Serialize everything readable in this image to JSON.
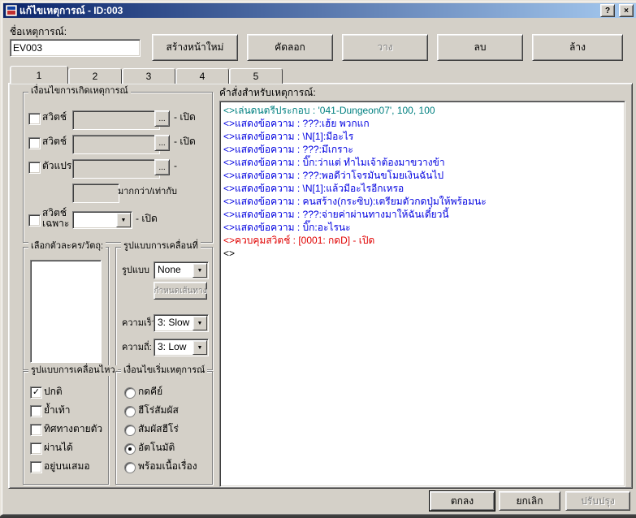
{
  "window": {
    "title": "แก้ไขเหตุการณ์ - ID:003"
  },
  "icons": {
    "help": "?",
    "close": "×",
    "dropdown_arrow": "▼",
    "spinner_up": "▲",
    "spinner_down": "▼",
    "ellipsis": "...",
    "check": "✓"
  },
  "header": {
    "name_label": "ชื่อเหตุการณ์:",
    "name_value": "EV003",
    "new_page_button": "สร้างหน้าใหม่",
    "copy_button": "คัดลอก",
    "paste_button": "วาง",
    "delete_button": "ลบ",
    "clear_button": "ล้าง"
  },
  "tabs": {
    "labels": [
      "1",
      "2",
      "3",
      "4",
      "5"
    ],
    "selected": "1"
  },
  "conditions": {
    "title": "เงื่อนไขการเกิดเหตุการณ์",
    "switch1": {
      "label": "สวิตช์",
      "value": "",
      "suffix": "- เปิด"
    },
    "switch2": {
      "label": "สวิตช์",
      "value": "",
      "suffix": "- เปิด"
    },
    "variable": {
      "label": "ตัวแปร",
      "value": "",
      "suffix": "-"
    },
    "compare": {
      "label": "มากกว่า/เท่ากับ",
      "value": ""
    },
    "self_switch": {
      "label_line1": "สวิตช์",
      "label_line2": "เฉพาะ",
      "value": "",
      "suffix": "- เปิด"
    }
  },
  "graphic": {
    "title": "เลือกตัวละคร/วัตถุ:"
  },
  "movement": {
    "title": "รูปแบบการเคลื่อนที่",
    "type_label": "รูปแบบ",
    "type_value": "None",
    "route_button": "กำหนดเส้นทาง",
    "speed_label": "ความเร็ว:",
    "speed_value": "3: Slow",
    "frequency_label": "ความถี่:",
    "frequency_value": "3: Low"
  },
  "options": {
    "title": "รูปแบบการเคลื่อนไหว",
    "items": [
      {
        "label": "ปกติ",
        "checked": true
      },
      {
        "label": "ย้ำเท้า",
        "checked": false
      },
      {
        "label": "ทิศทางตายตัว",
        "checked": false
      },
      {
        "label": "ผ่านได้",
        "checked": false
      },
      {
        "label": "อยู่บนเสมอ",
        "checked": false
      }
    ]
  },
  "trigger": {
    "title": "เงื่อนไขเริ่มเหตุการณ์",
    "items": [
      {
        "label": "กดคีย์",
        "selected": false
      },
      {
        "label": "ฮีโร่สัมผัส",
        "selected": false
      },
      {
        "label": "สัมผัสฮีโร่",
        "selected": false
      },
      {
        "label": "อัตโนมัติ",
        "selected": true
      },
      {
        "label": "พร้อมเนื้อเรื่อง",
        "selected": false
      }
    ]
  },
  "commands": {
    "title": "คำสั่งสำหรับเหตุการณ์:",
    "lines": [
      {
        "text": "<>เล่นดนตรีประกอบ : '041-Dungeon07', 100, 100",
        "color": "#008080"
      },
      {
        "text": "<>แสดงข้อความ : ???:เฮ้ย พวกแก",
        "color": "#0000e0"
      },
      {
        "text": "<>แสดงข้อความ : \\N[1]:มีอะไร",
        "color": "#0000e0"
      },
      {
        "text": "<>แสดงข้อความ : ???:มึเกราะ",
        "color": "#0000e0"
      },
      {
        "text": "<>แสดงข้อความ : บิ๊ก:ว่าแต่ ทำไมเจ้าต้องมาขวางข้า",
        "color": "#0000e0"
      },
      {
        "text": "<>แสดงข้อความ : ???:พอดีว่าโจรมันขโมยเงินฉันไป",
        "color": "#0000e0"
      },
      {
        "text": "<>แสดงข้อความ : \\N[1]:แล้วมีอะไรอีกเหรอ",
        "color": "#0000e0"
      },
      {
        "text": "<>แสดงข้อความ : คนสร้าง(กระซิบ):เตรียมตัวกดปุ่มให้พร้อมนะ",
        "color": "#0000e0"
      },
      {
        "text": "<>แสดงข้อความ : ???:จ่ายค่าผ่านทางมาให้ฉันเดี๋ยวนี้",
        "color": "#0000e0"
      },
      {
        "text": "<>แสดงข้อความ : บิ๊ก:อะไรนะ",
        "color": "#0000e0"
      },
      {
        "text": "<>ควบคุมสวิตช์ : [0001: กดD] - เปิด",
        "color": "#e00000"
      },
      {
        "text": "<>",
        "color": "#000000"
      }
    ]
  },
  "footer": {
    "ok_button": "ตกลง",
    "cancel_button": "ยกเลิก",
    "apply_button": "ปรับปรุง"
  },
  "colors": {
    "titlebar_start": "#0a246a",
    "titlebar_end": "#a6caf0",
    "dialog_bg": "#d4d0c8",
    "command_music": "#008080",
    "command_message": "#0000e0",
    "command_switch": "#e00000"
  }
}
